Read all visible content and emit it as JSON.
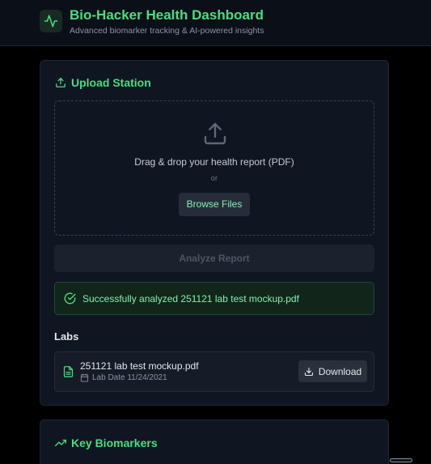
{
  "header": {
    "title": "Bio-Hacker Health Dashboard",
    "subtitle": "Advanced biomarker tracking & AI-powered insights",
    "logo_icon": "activity-icon"
  },
  "upload_station": {
    "title": "Upload Station",
    "title_icon": "upload-icon",
    "dropzone": {
      "icon": "upload-icon",
      "text": "Drag & drop your health report (PDF)",
      "or_text": "or",
      "browse_label": "Browse Files"
    },
    "analyze_label": "Analyze Report",
    "success_message": "Successfully analyzed 251121 lab test mockup.pdf",
    "success_icon": "check-circle-icon"
  },
  "labs": {
    "heading": "Labs",
    "items": [
      {
        "file_name": "251121 lab test mockup.pdf",
        "date_label": "Lab Date 11/24/2021",
        "icon": "file-text-icon",
        "date_icon": "calendar-icon",
        "download_label": "Download",
        "download_icon": "download-icon"
      }
    ]
  },
  "key_biomarkers": {
    "title": "Key Biomarkers",
    "title_icon": "trending-up-icon"
  },
  "colors": {
    "accent": "#4ade80",
    "background": "#000000",
    "card": "#0f1521",
    "success_bg": "#11251b"
  }
}
